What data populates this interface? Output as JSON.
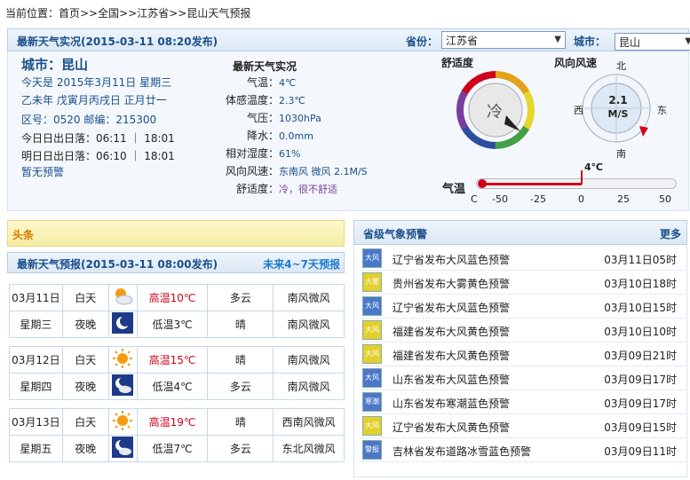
{
  "breadcrumb": "当前位置：首页>>全国>>江苏省>>昆山天气预报",
  "live": {
    "header": "最新天气实况(2015-03-11 08:20发布)",
    "province_label": "省份：",
    "province": "江苏省",
    "city_label": "城市：",
    "city": "昆山",
    "city_title": "城市：昆山",
    "today": "今天是 2015年3月11日 星期三",
    "lunar": "乙未年 戊寅月丙戌日 正月廿一",
    "codes": "区号：0520 邮编：215300",
    "sun_today": "今日日出日落：06:11 ｜ 18:01",
    "sun_tomorrow": "明日日出日落：06:10 ｜ 18:01",
    "no_warning": "暂无预警",
    "obs_title": "最新天气实况",
    "obs": [
      {
        "label": "气温：",
        "value": "4℃"
      },
      {
        "label": "体感温度：",
        "value": "2.3℃"
      },
      {
        "label": "气压：",
        "value": "1030hPa"
      },
      {
        "label": "降水：",
        "value": "0.0mm"
      },
      {
        "label": "相对湿度：",
        "value": "61%"
      },
      {
        "label": "风向风速：",
        "value": "东南风 微风 2.1M/S"
      },
      {
        "label": "舒适度：",
        "value": "冷，很不舒适"
      }
    ],
    "comfort_title": "舒适度",
    "comfort_value": "冷",
    "wind_title": "风向风速",
    "wind_value": "2.1",
    "wind_unit": "M/S",
    "dirs": {
      "n": "北",
      "s": "南",
      "e": "东",
      "w": "西"
    },
    "temp_label": "气温",
    "temp_marker": "4℃",
    "temp_value": 4,
    "temp_ticks": [
      "C",
      "-50",
      "-25",
      "0",
      "25",
      "50"
    ]
  },
  "headline_tab": "头条",
  "forecast": {
    "header": "最新天气预报(2015-03-11 08:00发布)",
    "more": "未来4~7天预报",
    "days": [
      {
        "date": "03月11日",
        "weekday": "星期三",
        "day": {
          "period": "白天",
          "temp": "高温10℃",
          "weather": "多云",
          "wind": "南风微风",
          "icon": "partly-cloudy-icon"
        },
        "night": {
          "period": "夜晚",
          "temp": "低温3℃",
          "weather": "晴",
          "wind": "南风微风",
          "icon": "moon-icon"
        }
      },
      {
        "date": "03月12日",
        "weekday": "星期四",
        "day": {
          "period": "白天",
          "temp": "高温15℃",
          "weather": "晴",
          "wind": "南风微风",
          "icon": "sun-icon"
        },
        "night": {
          "period": "夜晚",
          "temp": "低温4℃",
          "weather": "多云",
          "wind": "南风微风",
          "icon": "moon-cloud-icon"
        }
      },
      {
        "date": "03月13日",
        "weekday": "星期五",
        "day": {
          "period": "白天",
          "temp": "高温19℃",
          "weather": "晴",
          "wind": "西南风微风",
          "icon": "sun-icon"
        },
        "night": {
          "period": "夜晚",
          "temp": "低温7℃",
          "weather": "多云",
          "wind": "东北风微风",
          "icon": "moon-cloud-icon"
        }
      }
    ]
  },
  "warnings": {
    "header": "省级气象预警",
    "more": "更多",
    "items": [
      {
        "title": "辽宁省发布大风蓝色预警",
        "date": "03月11日05时",
        "icon_label": "大风",
        "color": "#4a78c8"
      },
      {
        "title": "贵州省发布大雾黄色预警",
        "date": "03月10日18时",
        "icon_label": "大雾",
        "color": "#e2d02c"
      },
      {
        "title": "辽宁省发布大风蓝色预警",
        "date": "03月10日15时",
        "icon_label": "大风",
        "color": "#4a78c8"
      },
      {
        "title": "福建省发布大风黄色预警",
        "date": "03月10日10时",
        "icon_label": "大风",
        "color": "#e2d02c"
      },
      {
        "title": "福建省发布大风黄色预警",
        "date": "03月09日21时",
        "icon_label": "大风",
        "color": "#e2d02c"
      },
      {
        "title": "山东省发布大风蓝色预警",
        "date": "03月09日17时",
        "icon_label": "大风",
        "color": "#4a78c8"
      },
      {
        "title": "山东省发布寒潮蓝色预警",
        "date": "03月09日17时",
        "icon_label": "寒潮",
        "color": "#4a78c8"
      },
      {
        "title": "辽宁省发布大风黄色预警",
        "date": "03月09日15时",
        "icon_label": "大风",
        "color": "#e2d02c"
      },
      {
        "title": "吉林省发布道路冰雪蓝色预警",
        "date": "03月09日11时",
        "icon_label": "警报",
        "color": "#4a78c8"
      }
    ]
  }
}
